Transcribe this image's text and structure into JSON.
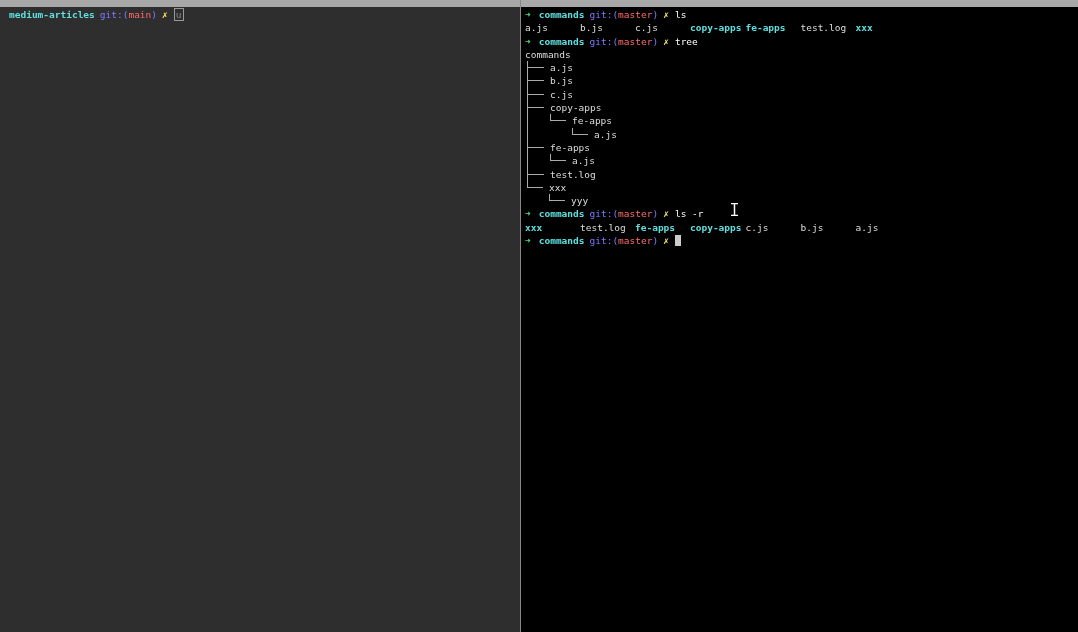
{
  "left_pane": {
    "prompt": {
      "directory": "medium-articles",
      "git_label": "git:(",
      "branch": "main",
      "git_close": ")",
      "status": "✗",
      "input": "u"
    }
  },
  "right_pane": {
    "lines": [
      {
        "kind": "prompt",
        "arrow": "➜",
        "directory": "commands",
        "git_label": "git:(",
        "branch": "master",
        "git_close": ")",
        "status": "✗",
        "command": "ls"
      },
      {
        "kind": "listing",
        "entries": [
          {
            "name": "a.js",
            "kind": "file"
          },
          {
            "name": "b.js",
            "kind": "file"
          },
          {
            "name": "c.js",
            "kind": "file"
          },
          {
            "name": "copy-apps",
            "kind": "dir"
          },
          {
            "name": "fe-apps",
            "kind": "dir"
          },
          {
            "name": "test.log",
            "kind": "file"
          },
          {
            "name": "xxx",
            "kind": "dir"
          }
        ]
      },
      {
        "kind": "prompt",
        "arrow": "➜",
        "directory": "commands",
        "git_label": "git:(",
        "branch": "master",
        "git_close": ")",
        "status": "✗",
        "command": "tree"
      },
      {
        "kind": "tree",
        "root": "commands",
        "children": [
          {
            "name": "a.js"
          },
          {
            "name": "b.js"
          },
          {
            "name": "c.js"
          },
          {
            "name": "copy-apps",
            "children": [
              {
                "name": "fe-apps",
                "children": [
                  {
                    "name": "a.js"
                  }
                ]
              }
            ]
          },
          {
            "name": "fe-apps",
            "children": [
              {
                "name": "a.js"
              }
            ]
          },
          {
            "name": "test.log"
          },
          {
            "name": "xxx",
            "children": [
              {
                "name": "yyy"
              }
            ]
          }
        ]
      },
      {
        "kind": "prompt",
        "arrow": "➜",
        "directory": "commands",
        "git_label": "git:(",
        "branch": "master",
        "git_close": ")",
        "status": "✗",
        "command": "ls -r"
      },
      {
        "kind": "listing",
        "entries": [
          {
            "name": "xxx",
            "kind": "dir"
          },
          {
            "name": "test.log",
            "kind": "file"
          },
          {
            "name": "fe-apps",
            "kind": "dir"
          },
          {
            "name": "copy-apps",
            "kind": "dir"
          },
          {
            "name": "c.js",
            "kind": "file"
          },
          {
            "name": "b.js",
            "kind": "file"
          },
          {
            "name": "a.js",
            "kind": "file"
          }
        ]
      },
      {
        "kind": "prompt",
        "arrow": "➜",
        "directory": "commands",
        "git_label": "git:(",
        "branch": "master",
        "git_close": ")",
        "status": "✗",
        "cursor": true
      }
    ]
  }
}
